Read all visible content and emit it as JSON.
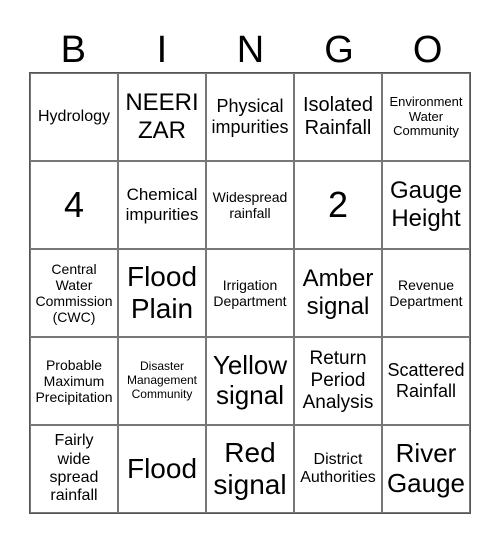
{
  "header": [
    "B",
    "I",
    "N",
    "G",
    "O"
  ],
  "cells": [
    "Hydrology",
    "NEERI\nZAR",
    "Physical\nimpurities",
    "Isolated\nRainfall",
    "Environment\nWater\nCommunity",
    "4",
    "Chemical\nimpurities",
    "Widespread\nrainfall",
    "2",
    "Gauge\nHeight",
    "Central\nWater\nCommission\n(CWC)",
    "Flood\nPlain",
    "Irrigation\nDepartment",
    "Amber\nsignal",
    "Revenue\nDepartment",
    "Probable\nMaximum\nPrecipitation",
    "Disaster\nManagement\nCommunity",
    "Yellow\nsignal",
    "Return\nPeriod\nAnalysis",
    "Scattered\nRainfall",
    "Fairly\nwide\nspread\nrainfall",
    "Flood",
    "Red\nsignal",
    "District\nAuthorities",
    "River\nGauge"
  ]
}
